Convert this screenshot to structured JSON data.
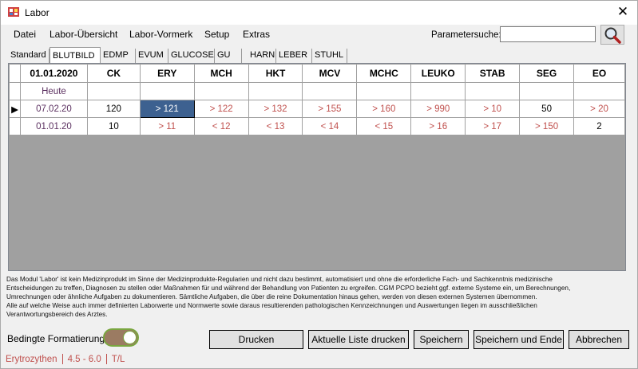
{
  "window": {
    "title": "Labor"
  },
  "menu": [
    "Datei",
    "Labor-Übersicht",
    "Labor-Vormerk",
    "Setup",
    "Extras"
  ],
  "parameter_search": {
    "label": "Parametersuche:",
    "value": ""
  },
  "tabs": [
    {
      "label": "Standard",
      "active": false
    },
    {
      "label": "BLUTBILD",
      "active": true
    },
    {
      "label": "EDMP",
      "active": false
    },
    {
      "label": "EVUM",
      "active": false
    },
    {
      "label": "GLUCOSE",
      "active": false
    },
    {
      "label": "GU",
      "active": false
    },
    {
      "label": "HARN",
      "active": false
    },
    {
      "label": "LEBER",
      "active": false
    },
    {
      "label": "STUHL",
      "active": false
    }
  ],
  "grid": {
    "date_header": "01.01.2020",
    "columns": [
      "CK",
      "ERY",
      "MCH",
      "HKT",
      "MCV",
      "MCHC",
      "LEUKO",
      "STAB",
      "SEG",
      "EO"
    ],
    "rows": [
      {
        "date": "Heute",
        "marker": "",
        "cells": [
          "",
          "",
          "",
          "",
          "",
          "",
          "",
          "",
          "",
          ""
        ]
      },
      {
        "date": "07.02.20",
        "marker": "▶",
        "cells": [
          "120",
          "> 121",
          "> 122",
          "> 132",
          "> 155",
          "> 160",
          "> 990",
          "> 10",
          "50",
          "> 20"
        ]
      },
      {
        "date": "01.01.20",
        "marker": "",
        "cells": [
          "10",
          "> 11",
          "< 12",
          "< 13",
          "< 14",
          "< 15",
          "> 16",
          "> 17",
          "> 150",
          "2"
        ]
      }
    ]
  },
  "disclaimer": [
    "Das Modul 'Labor' ist kein Medizinprodukt im Sinne der Medizinprodukte-Regularien und nicht dazu bestimmt, automatisiert und ohne die erforderliche Fach- und Sachkenntnis medizinische",
    "Entscheidungen zu treffen, Diagnosen zu stellen oder Maßnahmen für und während der Behandlung von Patienten zu ergreifen. CGM PCPO bezieht ggf. externe Systeme ein, um Berechnungen,",
    "Umrechnungen oder ähnliche Aufgaben zu dokumentieren. Sämtliche Aufgaben, die über die reine Dokumentation hinaus gehen, werden von diesen externen Systemen übernommen.",
    "Alle auf welche Weise auch immer definierten Laborwerte und Normwerte sowie daraus resultierenden pathologischen Kennzeichnungen und Auswertungen liegen im ausschließlichen",
    "Verantwortungsbereich des Arztes."
  ],
  "conditional_formatting": {
    "label": "Bedingte Formatierung:",
    "enabled": true
  },
  "buttons": {
    "print": "Drucken",
    "print_list": "Aktuelle Liste drucken",
    "save": "Speichern",
    "save_end": "Speichern und Ende",
    "cancel": "Abbrechen"
  },
  "status": {
    "name": "Erytrozythen",
    "range": "4.5 - 6.0",
    "unit": "T/L"
  },
  "colors": {
    "abnormal": "#c0504d",
    "selection": "#3d6190",
    "date": "#5b3060",
    "toggle_on": "#7aa640"
  }
}
